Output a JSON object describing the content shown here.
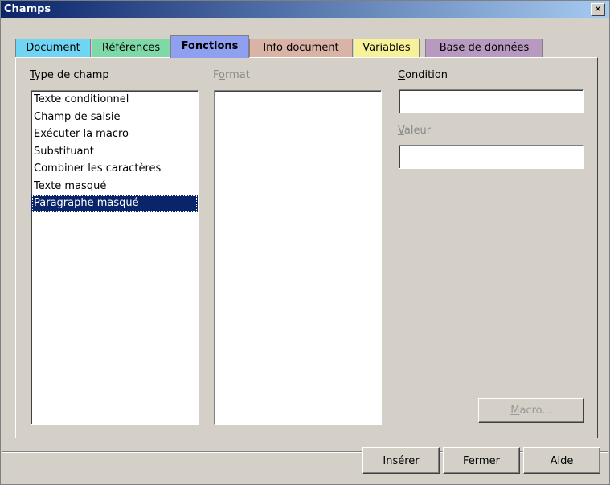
{
  "window": {
    "title": "Champs",
    "close_glyph": "✕"
  },
  "tabs": [
    {
      "label": "Document",
      "color": "#6fd5f2",
      "active": false
    },
    {
      "label": "Références",
      "color": "#7ed9a6",
      "active": false
    },
    {
      "label": "Fonctions",
      "color": "#8fa0f0",
      "active": true
    },
    {
      "label": "Info document",
      "color": "#d9b4a6",
      "active": false
    },
    {
      "label": "Variables",
      "color": "#f7f29a",
      "active": false
    },
    {
      "label": "Base de données",
      "color": "#b89ac0",
      "active": false
    }
  ],
  "field_type": {
    "label_first": "T",
    "label_rest": "ype de champ",
    "items": [
      "Texte conditionnel",
      "Champ de saisie",
      "Exécuter la macro",
      "Substituant",
      "Combiner les caractères",
      "Texte masqué",
      "Paragraphe masqué"
    ],
    "selected_index": 6
  },
  "format": {
    "label_pre": "F",
    "label_mid": "o",
    "label_post": "rmat"
  },
  "condition": {
    "label_first": "C",
    "label_rest": "ondition",
    "value": ""
  },
  "valeur": {
    "label_first": "V",
    "label_rest": "aleur",
    "value": ""
  },
  "buttons": {
    "macro_first": "M",
    "macro_rest": "acro...",
    "insert": "Insérer",
    "close": "Fermer",
    "help": "Aide"
  }
}
